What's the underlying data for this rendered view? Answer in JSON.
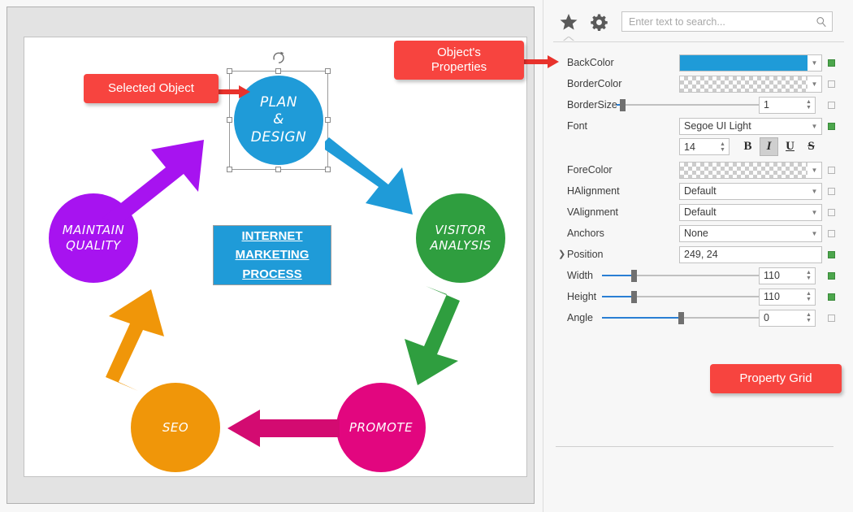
{
  "designer": {
    "diagram_title_lines": [
      "INTERNET",
      "MARKETING",
      "PROCESS"
    ],
    "nodes": [
      {
        "id": "plan",
        "lines": [
          "PLAN",
          "&",
          "DESIGN"
        ],
        "color": "#1f9bd8",
        "selected": true
      },
      {
        "id": "visitor",
        "lines": [
          "VISITOR",
          "ANALYSIS"
        ],
        "color": "#2f9e3f",
        "selected": false
      },
      {
        "id": "promote",
        "lines": [
          "PROMOTE"
        ],
        "color": "#e2067f",
        "selected": false
      },
      {
        "id": "seo",
        "lines": [
          "SEO"
        ],
        "color": "#f09609",
        "selected": false
      },
      {
        "id": "maintain",
        "lines": [
          "MAINTAIN",
          "QUALITY"
        ],
        "color": "#a713f0",
        "selected": false
      }
    ],
    "arrows": [
      {
        "from": "plan",
        "to": "visitor",
        "color": "#1f9bd8"
      },
      {
        "from": "visitor",
        "to": "promote",
        "color": "#2f9e3f"
      },
      {
        "from": "promote",
        "to": "seo",
        "color": "#e2067f"
      },
      {
        "from": "seo",
        "to": "maintain",
        "color": "#f09609"
      },
      {
        "from": "maintain",
        "to": "plan",
        "color": "#a713f0"
      }
    ]
  },
  "callouts": {
    "selected_object": "Selected Object",
    "object_properties_line1": "Object's",
    "object_properties_line2": "Properties",
    "property_grid": "Property Grid",
    "color": "#f7443f"
  },
  "property_grid": {
    "tabs": [
      {
        "name": "favorites",
        "icon": "star-icon",
        "active": true
      },
      {
        "name": "settings",
        "icon": "gear-icon",
        "active": false
      }
    ],
    "search": {
      "placeholder": "Enter text to search...",
      "value": "",
      "icon": "search-icon"
    },
    "rows": [
      {
        "label": "BackColor",
        "type": "color",
        "value": "#1f9bd8",
        "transparent": false,
        "marker": "on"
      },
      {
        "label": "BorderColor",
        "type": "color",
        "value": "transparent",
        "transparent": true,
        "marker": "off"
      },
      {
        "label": "BorderSize",
        "type": "slider",
        "value": "1",
        "fill_pct": 2,
        "marker": "off"
      },
      {
        "label": "Font",
        "type": "dropdown",
        "value": "Segoe UI Light",
        "marker": "on"
      },
      {
        "label": "ForeColor",
        "type": "color",
        "value": "transparent",
        "transparent": true,
        "marker": "off"
      },
      {
        "label": "HAlignment",
        "type": "dropdown",
        "value": "Default",
        "marker": "off"
      },
      {
        "label": "VAlignment",
        "type": "dropdown",
        "value": "Default",
        "marker": "off"
      },
      {
        "label": "Anchors",
        "type": "dropdown",
        "value": "None",
        "marker": "off"
      },
      {
        "label": "Position",
        "type": "text",
        "value": "249, 24",
        "marker": "on",
        "expandable": true
      },
      {
        "label": "Width",
        "type": "slider",
        "value": "110",
        "fill_pct": 20,
        "marker": "on"
      },
      {
        "label": "Height",
        "type": "slider",
        "value": "110",
        "fill_pct": 20,
        "marker": "on"
      },
      {
        "label": "Angle",
        "type": "slider",
        "value": "0",
        "fill_pct": 50,
        "marker": "off"
      }
    ],
    "font_size": "14",
    "style_buttons": [
      {
        "name": "bold",
        "glyph": "B",
        "active": false
      },
      {
        "name": "italic",
        "glyph": "I",
        "active": true
      },
      {
        "name": "underline",
        "glyph": "U",
        "active": false
      },
      {
        "name": "strikethrough",
        "glyph": "S",
        "active": false
      }
    ]
  }
}
